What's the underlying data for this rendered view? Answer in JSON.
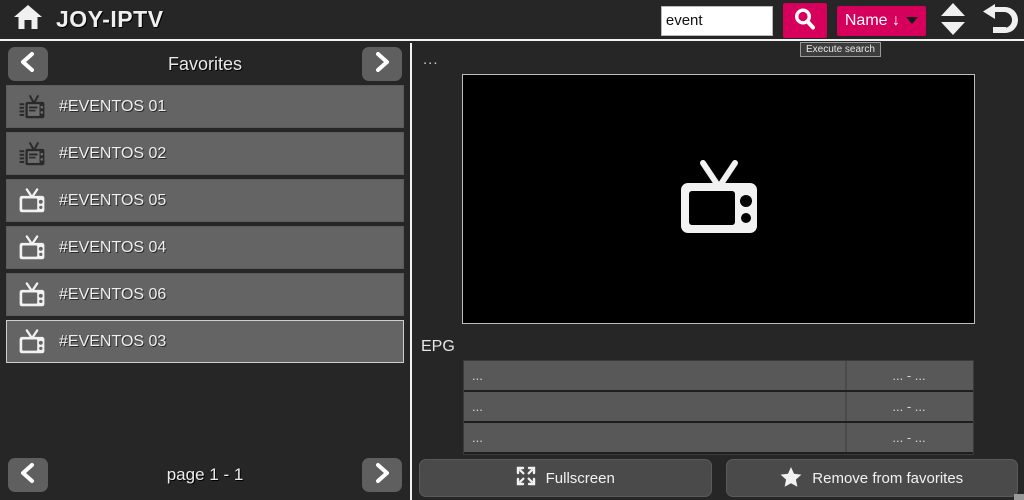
{
  "header": {
    "home_icon": "home-icon",
    "brand": "JOY-IPTV",
    "search": {
      "value": "event",
      "placeholder": ""
    },
    "search_button_icon": "search-icon",
    "sort": {
      "label": "Name ↓",
      "caret_icon": "chevron-down-icon"
    },
    "stepper_icon": "up-down-arrows-icon",
    "back_icon": "undo-back-icon",
    "tooltip": "Execute search",
    "accent_color": "#d6005c"
  },
  "sidebar": {
    "prev_icon": "chevron-left-icon",
    "title": "Favorites",
    "next_icon": "chevron-right-icon",
    "items": [
      {
        "label": "#EVENTOS 01",
        "icon": "tv-logo-icon",
        "selected": false
      },
      {
        "label": "#EVENTOS 02",
        "icon": "tv-logo-icon",
        "selected": false
      },
      {
        "label": "#EVENTOS 05",
        "icon": "tv-icon",
        "selected": false
      },
      {
        "label": "#EVENTOS 04",
        "icon": "tv-icon",
        "selected": false
      },
      {
        "label": "#EVENTOS 06",
        "icon": "tv-icon",
        "selected": false
      },
      {
        "label": "#EVENTOS 03",
        "icon": "tv-icon",
        "selected": true
      }
    ],
    "pager": {
      "prev_icon": "chevron-left-icon",
      "text": "page 1 - 1",
      "next_icon": "chevron-right-icon"
    }
  },
  "main": {
    "channel_title": "...",
    "player": {
      "placeholder_icon": "tv-icon",
      "background": "#000000"
    },
    "epg_label": "EPG",
    "epg_rows": [
      {
        "name": "...",
        "time": "... - ..."
      },
      {
        "name": "...",
        "time": "... - ..."
      },
      {
        "name": "...",
        "time": "... - ..."
      }
    ],
    "actions": [
      {
        "label": "Fullscreen",
        "icon": "fullscreen-icon"
      },
      {
        "label": "Remove from favorites",
        "icon": "star-icon"
      }
    ]
  }
}
